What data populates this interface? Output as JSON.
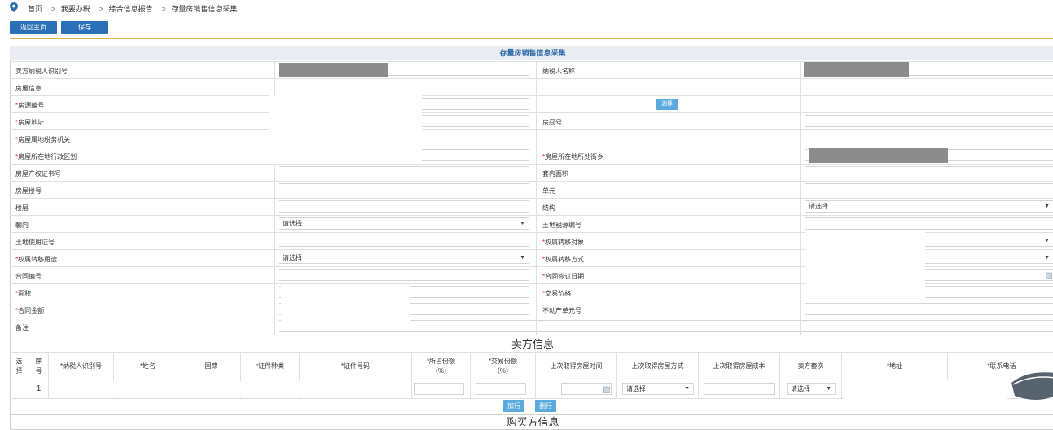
{
  "breadcrumb": {
    "items": [
      "首页",
      "我要办税",
      "综合信息报告",
      "存量房销售信息采集"
    ],
    "separator": ">"
  },
  "toolbar": {
    "back_label": "返回主页",
    "save_label": "保存"
  },
  "form": {
    "title": "存量房销售信息采集",
    "seller_taxpayer_id_label": "卖方纳税人识别号",
    "taxpayer_name_label": "纳税人名称",
    "house_info_label": "房屋信息",
    "house_source_no_label": "房源编号",
    "choose_button": "选择",
    "house_address_label": "房屋地址",
    "room_no_label": "房间号",
    "tax_authority_label": "房屋属地税务机关",
    "admin_district_label": "房屋所在地行政区划",
    "street_label": "房屋所在地所处街乡",
    "property_cert_label": "房屋产权证书号",
    "inner_area_label": "套内面积",
    "building_no_label": "房屋楼号",
    "unit_label": "单元",
    "floor_label": "楼层",
    "structure_label": "结构",
    "structure_value": "请选择",
    "orientation_label": "朝向",
    "orientation_value": "请选择",
    "land_source_label": "土地税源编号",
    "land_use_cert_label": "土地使用证号",
    "transfer_object_label": "权属转移对象",
    "transfer_use_label": "权属转移用途",
    "transfer_use_value": "请选择",
    "transfer_method_label": "权属转移方式",
    "contract_no_label": "合同编号",
    "contract_date_label": "合同签订日期",
    "area_label": "面积",
    "trade_price_label": "交易价格",
    "contract_amount_label": "合同金额",
    "realty_unit_label": "不动产单元号",
    "remark_label": "备注",
    "required_mark": "*"
  },
  "seller": {
    "title": "卖方信息",
    "columns": [
      "选择",
      "序号",
      "*纳税人识别号",
      "*姓名",
      "国籍",
      "*证件种类",
      "*证件号码",
      "*所占份额（%）",
      "*交易份额（%）",
      "上次取得房屋时间",
      "上次取得房屋方式",
      "上次取得房屋成本",
      "卖方套次",
      "*地址",
      "*联系电话"
    ],
    "col_select_1": "选",
    "col_select_2": "择",
    "col_seq_1": "序",
    "col_seq_2": "号",
    "col_share_1": "*所占份额",
    "col_share_2": "（%）",
    "col_trade_1": "*交易份额",
    "col_trade_2": "（%）",
    "row_index": "1",
    "acquire_method_value": "请选择",
    "seller_count_value": "请选择",
    "add_button": "加行",
    "delete_button": "删行"
  },
  "buyer": {
    "title": "购买方信息"
  }
}
